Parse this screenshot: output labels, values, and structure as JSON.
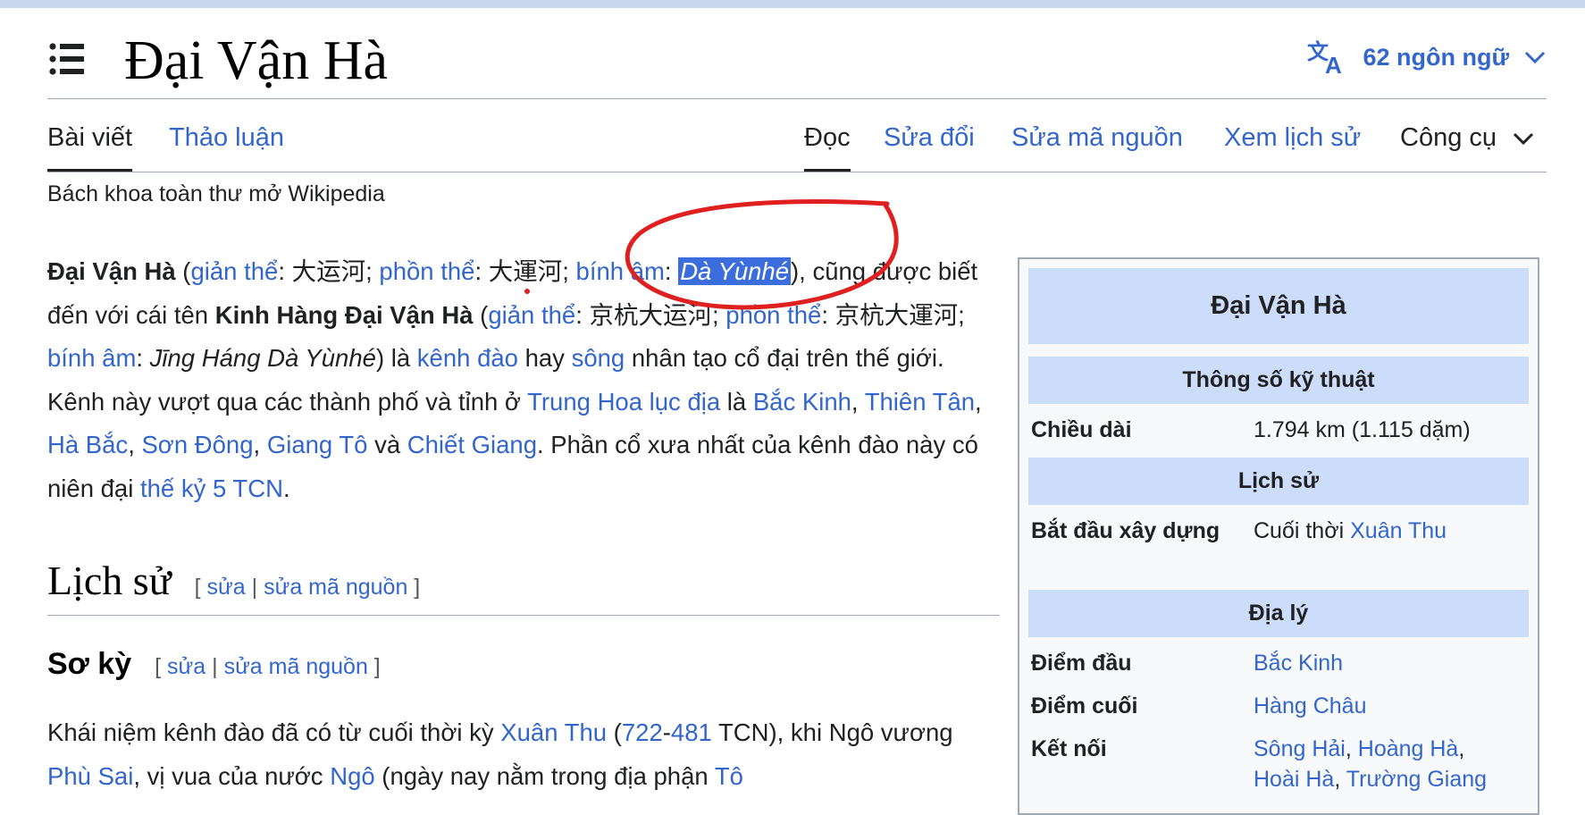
{
  "title": "Đại Vận Hà",
  "languages": {
    "label": "62 ngôn ngữ"
  },
  "tabs": {
    "article": "Bài viết",
    "talk": "Thảo luận",
    "read": "Đọc",
    "edit": "Sửa đổi",
    "edit_source": "Sửa mã nguồn",
    "history": "Xem lịch sử",
    "tools": "Công cụ"
  },
  "tagline": "Bách khoa toàn thư mở Wikipedia",
  "intro": {
    "bold_name": "Đại Vận Hà",
    "open_paren": " (",
    "simplified_label": "giản thể",
    "simplified_text": ": 大运河; ",
    "traditional_label": "phồn thể",
    "traditional_text": ": 大運河; ",
    "pinyin_label": "bính âm",
    "pinyin_sep": ": ",
    "pinyin_value": "Dà Yùnhé",
    "after_pinyin": "), cũng được biết đến với cái tên ",
    "bold_alt": "Kinh Hàng Đại Vận Hà",
    "open_paren_2": " (",
    "simplified_label_2": "giản thể",
    "simplified_text_2": ": 京杭大运河; ",
    "traditional_label_2": "phồn thể",
    "traditional_text_2": ": 京杭大運河; ",
    "pinyin_label_2": "bính âm",
    "pinyin_sep_2": ": ",
    "pinyin_value_2": "Jīng Háng Dà Yùnhé",
    "after_pinyin_2": ") là ",
    "canal_link": "kênh đào",
    "or_text": " hay ",
    "river_link": "sông",
    "text_1": " nhân tạo cổ đại trên thế giới. Kênh này vượt qua các thành phố và tỉnh ở ",
    "mainland_link": "Trung Hoa lục địa",
    "text_2": " là ",
    "beijing_link": "Bắc Kinh",
    "comma_1": ", ",
    "tianjin_link": "Thiên Tân",
    "comma_2": ", ",
    "hebei_link": "Hà Bắc",
    "comma_3": ", ",
    "shandong_link": "Sơn Đông",
    "comma_4": ", ",
    "jiangsu_link": "Giang Tô",
    "and_text": " và ",
    "zhejiang_link": "Chiết Giang",
    "text_3": ". Phần cổ xưa nhất của kênh đào này có niên đại ",
    "century_link": "thế kỷ 5 TCN",
    "period": "."
  },
  "section_history": {
    "title": "Lịch sử",
    "open": "[ ",
    "edit": "sửa",
    "sep": " | ",
    "edit_source": "sửa mã nguồn",
    "close": " ]"
  },
  "section_early": {
    "title": "Sơ kỳ",
    "open": "[ ",
    "edit": "sửa",
    "sep": " | ",
    "edit_source": "sửa mã nguồn",
    "close": " ]"
  },
  "para_early": {
    "text_1": "Khái niệm kênh đào đã có từ cuối thời kỳ ",
    "xuanthu_link": "Xuân Thu",
    "paren_open": " (",
    "year1_link": "722",
    "dash": "-",
    "year2_link": "481",
    "text_2": " TCN), khi Ngô vương ",
    "fuchai_link": "Phù Sai",
    "text_3": ", vị vua của nước ",
    "wu_link": "Ngô",
    "text_4": " (ngày nay nằm trong địa phận ",
    "suzhou_link": "Tô"
  },
  "infobox": {
    "title": "Đại Vận Hà",
    "header_specs": "Thông số kỹ thuật",
    "length_label": "Chiều dài",
    "length_value": "1.794 km (1.115 dặm)",
    "header_history": "Lịch sử",
    "construction_label": "Bắt đầu xây dựng",
    "construction_prefix": "Cuối thời ",
    "construction_link": "Xuân Thu",
    "header_geo": "Địa lý",
    "start_label": "Điểm đầu",
    "start_link": "Bắc Kinh",
    "end_label": "Điểm cuối",
    "end_link": "Hàng Châu",
    "connects_label": "Kết nối",
    "connects_link_1": "Sông Hải",
    "connects_sep_1": ", ",
    "connects_link_2": "Hoàng Hà",
    "connects_sep_2": ",",
    "connects_link_3": "Hoài Hà",
    "connects_sep_3": ", ",
    "connects_link_4": "Trường Giang"
  },
  "colors": {
    "link": "#3366cc",
    "infobox_header": "#ccdcfb",
    "selection": "#3c6ddc",
    "annotation": "#e02020"
  },
  "icons": {
    "toc": "list-bullets-icon",
    "language": "translate-icon",
    "chevron": "chevron-down-icon"
  }
}
